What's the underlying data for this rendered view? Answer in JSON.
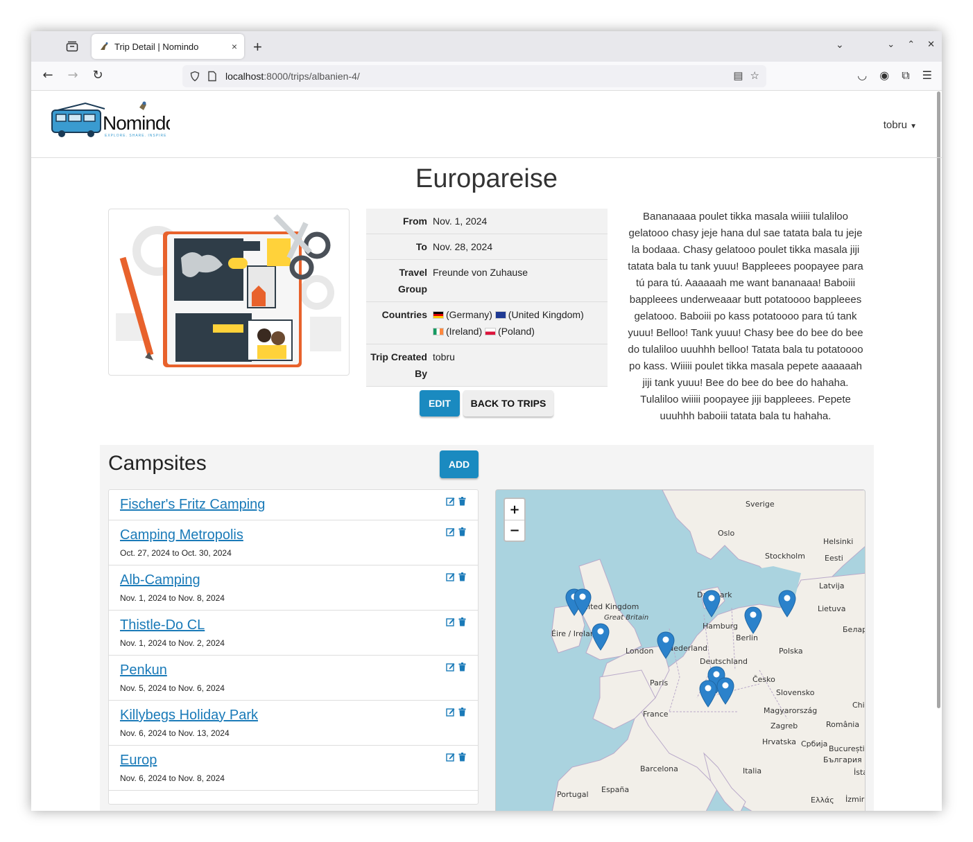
{
  "browser": {
    "tab_title": "Trip Detail | Nomindo",
    "tab_close": "×",
    "new_tab": "+",
    "url_host": "localhost",
    "url_rest": ":8000/trips/albanien-4/"
  },
  "header": {
    "logo_text": "Nomindo",
    "logo_tagline": "EXPLORE. SHARE. INSPIRE",
    "user": "tobru"
  },
  "trip": {
    "title": "Europareise",
    "from_label": "From",
    "from": "Nov. 1, 2024",
    "to_label": "To",
    "to": "Nov. 28, 2024",
    "group_label": "Travel Group",
    "group": "Freunde von Zuhause",
    "countries_label": "Countries",
    "countries": [
      "(Germany)",
      "(United Kingdom)",
      "(Ireland)",
      "(Poland)"
    ],
    "created_label": "Trip Created By",
    "created_by": "tobru",
    "edit_label": "EDIT",
    "back_label": "BACK TO TRIPS",
    "description": "Bananaaaa poulet tikka masala wiiiii tulaliloo gelatooo chasy jeje hana dul sae tatata bala tu jeje la bodaaa. Chasy gelatooo poulet tikka masala jiji tatata bala tu tank yuuu! Bappleees poopayee para tú para tú. Aaaaaah me want bananaaa! Baboiii bappleees underweaaar butt potatoooo bappleees gelatooo. Baboiii po kass potatoooo para tú tank yuuu! Belloo! Tank yuuu! Chasy bee do bee do bee do tulaliloo uuuhhh belloo! Tatata bala tu potatoooo po kass. Wiiiii poulet tikka masala pepete aaaaaah jiji tank yuuu! Bee do bee do bee do hahaha. Tulaliloo wiiiii poopayee jiji bappleees. Pepete uuuhhh baboiii tatata bala tu hahaha."
  },
  "campsites": {
    "title": "Campsites",
    "add_label": "ADD",
    "items": [
      {
        "name": "Fischer's Fritz Camping",
        "dates": ""
      },
      {
        "name": "Camping Metropolis",
        "dates": "Oct. 27, 2024 to Oct. 30, 2024"
      },
      {
        "name": "Alb-Camping",
        "dates": "Nov. 1, 2024 to Nov. 8, 2024"
      },
      {
        "name": "Thistle-Do CL",
        "dates": "Nov. 1, 2024 to Nov. 2, 2024"
      },
      {
        "name": "Penkun",
        "dates": "Nov. 5, 2024 to Nov. 6, 2024"
      },
      {
        "name": "Killybegs Holiday Park",
        "dates": "Nov. 6, 2024 to Nov. 13, 2024"
      },
      {
        "name": "Europ",
        "dates": "Nov. 6, 2024 to Nov. 8, 2024"
      }
    ]
  },
  "map": {
    "zoom_in": "+",
    "zoom_out": "−",
    "labels": {
      "sverige": "Sverige",
      "oslo": "Oslo",
      "helsinki": "Helsinki",
      "stockholm": "Stockholm",
      "eesti": "Eesti",
      "latvija": "Latvija",
      "lietuva": "Lietuva",
      "belarus": "Белар",
      "danmark": "Danmark",
      "uk": "United Kingdom",
      "gb": "Great Britain",
      "eire": "Éire / Ireland",
      "hamburg": "Hamburg",
      "berlin": "Berlin",
      "polska": "Polska",
      "london": "London",
      "nederland": "Nederland",
      "deutschland": "Deutschland",
      "cesko": "Česko",
      "paris": "Paris",
      "slovensko": "Slovensko",
      "france": "France",
      "magyar": "Magyarország",
      "chi": "Chi",
      "zagreb": "Zagreb",
      "romania": "România",
      "hrvatska": "Hrvatska",
      "srbija": "Србија",
      "bucuresti": "București",
      "bulgaria": "България",
      "barcelona": "Barcelona",
      "italia": "Italia",
      "ista": "İsta",
      "portugal": "Portugal",
      "espana": "España",
      "ellas": "Ελλάς",
      "izmir": "İzmir"
    }
  }
}
